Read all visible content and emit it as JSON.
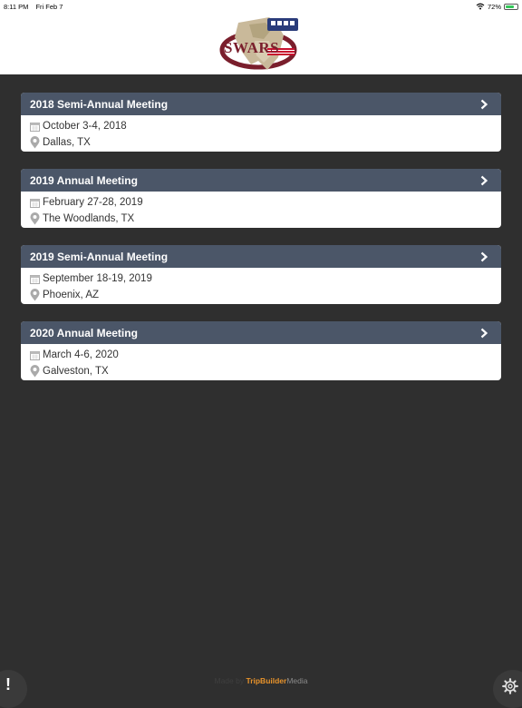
{
  "status": {
    "time": "8:11 PM",
    "date": "Fri Feb 7",
    "battery": "72%",
    "battery_level": 0.72
  },
  "logo": {
    "text": "SWARS"
  },
  "meetings": [
    {
      "title": "2018 Semi-Annual Meeting",
      "dates": "October 3-4, 2018",
      "location": "Dallas, TX"
    },
    {
      "title": "2019 Annual Meeting",
      "dates": "February 27-28, 2019",
      "location": "The Woodlands, TX"
    },
    {
      "title": "2019 Semi-Annual Meeting",
      "dates": "September 18-19, 2019",
      "location": "Phoenix, AZ"
    },
    {
      "title": "2020 Annual Meeting",
      "dates": "March 4-6, 2020",
      "location": "Galveston, TX"
    }
  ],
  "footer": {
    "prefix": "Made by ",
    "brand": "TripBuilder",
    "suffix": "Media"
  },
  "alert_symbol": "!",
  "colors": {
    "card_header": "#4b5668",
    "background": "#2f2f2f",
    "brand_orange": "#e8932b",
    "logo_red": "#7a1e2c"
  }
}
